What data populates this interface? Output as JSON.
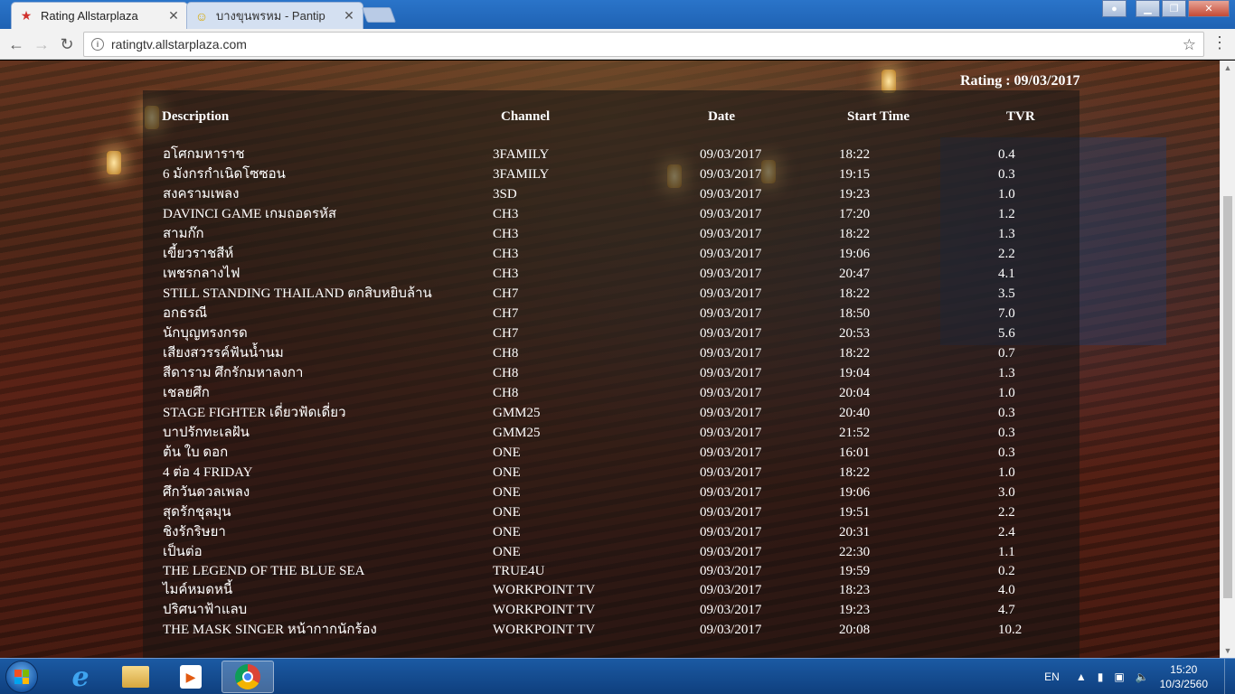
{
  "browser": {
    "tabs": [
      {
        "title": "Rating Allstarplaza",
        "icon": "star-icon",
        "active": true
      },
      {
        "title": "บางขุนพรหม - Pantip",
        "icon": "pantip-emoji-icon",
        "active": false
      }
    ],
    "address": "ratingtv.allstarplaza.com"
  },
  "page": {
    "rating_label": "Rating : 09/03/2017",
    "headers": {
      "description": "Description",
      "channel": "Channel",
      "date": "Date",
      "start_time": "Start Time",
      "tvr": "TVR"
    },
    "rows": [
      {
        "description": "อโศกมหาราช",
        "channel": "3FAMILY",
        "date": "09/03/2017",
        "start_time": "18:22",
        "tvr": "0.4"
      },
      {
        "description": "6 มังกรกำเนิดโซซอน",
        "channel": "3FAMILY",
        "date": "09/03/2017",
        "start_time": "19:15",
        "tvr": "0.3"
      },
      {
        "description": "สงครามเพลง",
        "channel": "3SD",
        "date": "09/03/2017",
        "start_time": "19:23",
        "tvr": "1.0"
      },
      {
        "description": "DAVINCI GAME เกมถอดรหัส",
        "channel": "CH3",
        "date": "09/03/2017",
        "start_time": "17:20",
        "tvr": "1.2"
      },
      {
        "description": "สามก๊ก",
        "channel": "CH3",
        "date": "09/03/2017",
        "start_time": "18:22",
        "tvr": "1.3"
      },
      {
        "description": "เขี้ยวราชสีห์",
        "channel": "CH3",
        "date": "09/03/2017",
        "start_time": "19:06",
        "tvr": "2.2"
      },
      {
        "description": "เพชรกลางไฟ",
        "channel": "CH3",
        "date": "09/03/2017",
        "start_time": "20:47",
        "tvr": "4.1"
      },
      {
        "description": "STILL STANDING THAILAND ตกสิบหยิบล้าน",
        "channel": "CH7",
        "date": "09/03/2017",
        "start_time": "18:22",
        "tvr": "3.5"
      },
      {
        "description": "อกธรณี",
        "channel": "CH7",
        "date": "09/03/2017",
        "start_time": "18:50",
        "tvr": "7.0"
      },
      {
        "description": "นักบุญทรงกรด",
        "channel": "CH7",
        "date": "09/03/2017",
        "start_time": "20:53",
        "tvr": "5.6"
      },
      {
        "description": "เสียงสวรรค์ฟันน้ำนม",
        "channel": "CH8",
        "date": "09/03/2017",
        "start_time": "18:22",
        "tvr": "0.7"
      },
      {
        "description": "สีดาราม ศึกรักมหาลงกา",
        "channel": "CH8",
        "date": "09/03/2017",
        "start_time": "19:04",
        "tvr": "1.3"
      },
      {
        "description": "เชลยศึก",
        "channel": "CH8",
        "date": "09/03/2017",
        "start_time": "20:04",
        "tvr": "1.0"
      },
      {
        "description": "STAGE FIGHTER เดี่ยวฟัดเดี่ยว",
        "channel": "GMM25",
        "date": "09/03/2017",
        "start_time": "20:40",
        "tvr": "0.3"
      },
      {
        "description": "บาปรักทะเลฝัน",
        "channel": "GMM25",
        "date": "09/03/2017",
        "start_time": "21:52",
        "tvr": "0.3"
      },
      {
        "description": "ต้น ใบ ดอก",
        "channel": "ONE",
        "date": "09/03/2017",
        "start_time": "16:01",
        "tvr": "0.3"
      },
      {
        "description": "4 ต่อ 4 FRIDAY",
        "channel": "ONE",
        "date": "09/03/2017",
        "start_time": "18:22",
        "tvr": "1.0"
      },
      {
        "description": "ศึกวันดวลเพลง",
        "channel": "ONE",
        "date": "09/03/2017",
        "start_time": "19:06",
        "tvr": "3.0"
      },
      {
        "description": "สุดรักชุลมุน",
        "channel": "ONE",
        "date": "09/03/2017",
        "start_time": "19:51",
        "tvr": "2.2"
      },
      {
        "description": "ชิงรักริษยา",
        "channel": "ONE",
        "date": "09/03/2017",
        "start_time": "20:31",
        "tvr": "2.4"
      },
      {
        "description": "เป็นต่อ",
        "channel": "ONE",
        "date": "09/03/2017",
        "start_time": "22:30",
        "tvr": "1.1"
      },
      {
        "description": "THE LEGEND OF THE BLUE SEA",
        "channel": "TRUE4U",
        "date": "09/03/2017",
        "start_time": "19:59",
        "tvr": "0.2"
      },
      {
        "description": "ไมค์หมดหนี้",
        "channel": "WORKPOINT TV",
        "date": "09/03/2017",
        "start_time": "18:23",
        "tvr": "4.0"
      },
      {
        "description": "ปริศนาฟ้าแลบ",
        "channel": "WORKPOINT TV",
        "date": "09/03/2017",
        "start_time": "19:23",
        "tvr": "4.7"
      },
      {
        "description": "THE MASK SINGER หน้ากากนักร้อง",
        "channel": "WORKPOINT TV",
        "date": "09/03/2017",
        "start_time": "20:08",
        "tvr": "10.2"
      }
    ]
  },
  "taskbar": {
    "language": "EN",
    "time": "15:20",
    "date": "10/3/2560"
  }
}
